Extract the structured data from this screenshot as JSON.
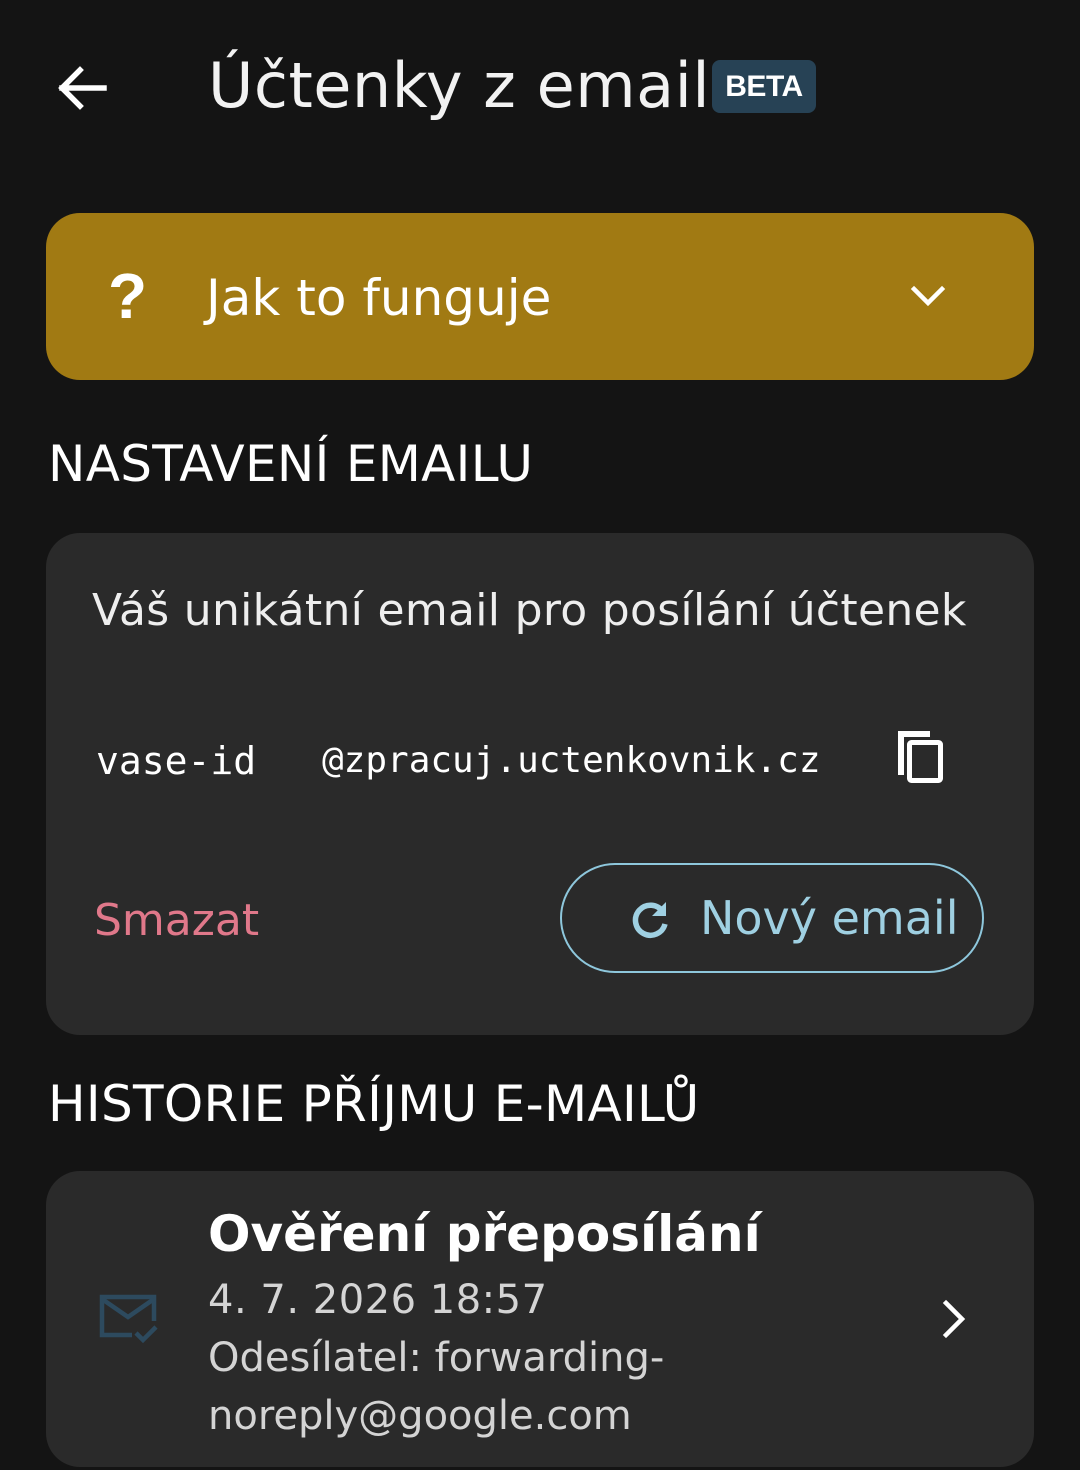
{
  "header": {
    "title": "Účtenky z emailu",
    "badge": "BETA",
    "back_icon": "arrow-left-icon"
  },
  "how_it_works": {
    "icon": "question-icon",
    "question_glyph": "?",
    "label": "Jak to funguje",
    "chevron_icon": "chevron-down-icon",
    "background": "#a17a13"
  },
  "email_settings": {
    "section_title": "NASTAVENÍ EMAILU",
    "caption": "Váš unikátní email pro posílání účtenek",
    "email_id": "vase-id",
    "email_domain": "@zpracuj.uctenkovnik.cz",
    "copy_icon": "copy-icon",
    "delete_label": "Smazat",
    "new_email_label": "Nový email",
    "refresh_icon": "refresh-icon",
    "delete_color": "#e0788a",
    "accent_color": "#9fd0e2"
  },
  "history": {
    "section_title": "HISTORIE PŘÍJMU E-MAILŮ",
    "items": [
      {
        "title": "Ověření přeposílání",
        "date": "4. 7. 2026 18:57",
        "sender": "Odesílatel: forwarding-noreply@google.com",
        "icon": "mail-check-icon",
        "chevron_icon": "chevron-right-icon"
      }
    ]
  }
}
